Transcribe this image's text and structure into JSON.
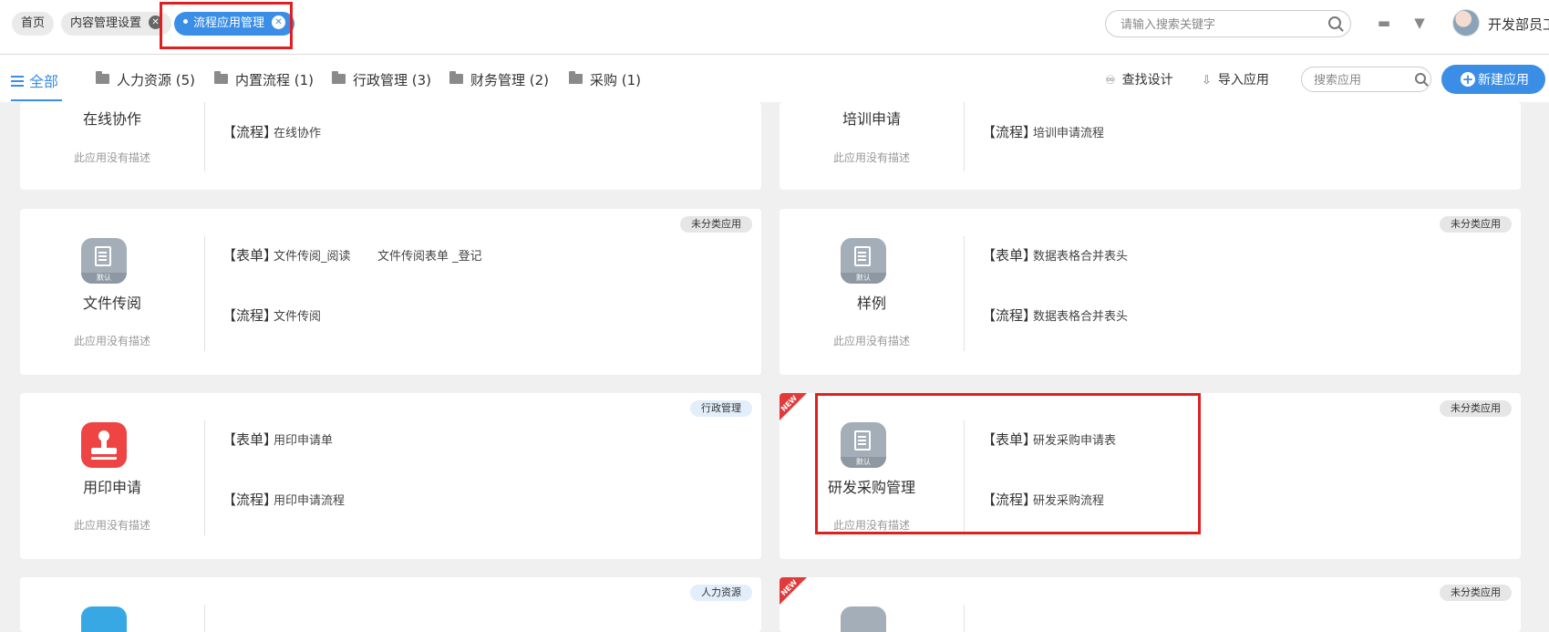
{
  "tabs": [
    {
      "label": "首页"
    },
    {
      "label": "内容管理设置"
    },
    {
      "label": "流程应用管理"
    }
  ],
  "search": {
    "placeholder": "请输入搜索关键字"
  },
  "user": {
    "name": "开发部员工"
  },
  "categories": {
    "all": "全部",
    "items": [
      {
        "label": "人力资源 (5)"
      },
      {
        "label": "内置流程 (1)"
      },
      {
        "label": "行政管理 (3)"
      },
      {
        "label": "财务管理 (2)"
      },
      {
        "label": "采购 (1)"
      }
    ],
    "find_design": "查找设计",
    "import_app": "导入应用",
    "app_search_placeholder": "搜索应用",
    "new_app": "新建应用"
  },
  "labels": {
    "form": "【表单】",
    "process": "【流程】",
    "no_desc": "此应用没有描述",
    "default_tag": "默认",
    "new_tag": "NEW"
  },
  "cards": [
    {
      "name": "在线协作",
      "category": "",
      "forms": [],
      "processes": [
        "在线协作"
      ]
    },
    {
      "name": "培训申请",
      "category": "",
      "forms": [],
      "processes": [
        "培训申请流程"
      ]
    },
    {
      "name": "文件传阅",
      "category": "未分类应用",
      "forms": [
        "文件传阅_阅读",
        "文件传阅表单 _登记"
      ],
      "processes": [
        "文件传阅"
      ]
    },
    {
      "name": "样例",
      "category": "未分类应用",
      "forms": [
        "数据表格合并表头"
      ],
      "processes": [
        "数据表格合并表头"
      ]
    },
    {
      "name": "用印申请",
      "category": "行政管理",
      "forms": [
        "用印申请单"
      ],
      "processes": [
        "用印申请流程"
      ]
    },
    {
      "name": "研发采购管理",
      "category": "未分类应用",
      "forms": [
        "研发采购申请表"
      ],
      "processes": [
        "研发采购流程"
      ]
    },
    {
      "name": "",
      "category": "人力资源",
      "forms": [],
      "processes": []
    },
    {
      "name": "",
      "category": "未分类应用",
      "forms": [],
      "processes": []
    }
  ],
  "colors": {
    "accent": "#3a8ee6",
    "highlight": "#e02020",
    "new_ribbon": "#e23a3a"
  }
}
